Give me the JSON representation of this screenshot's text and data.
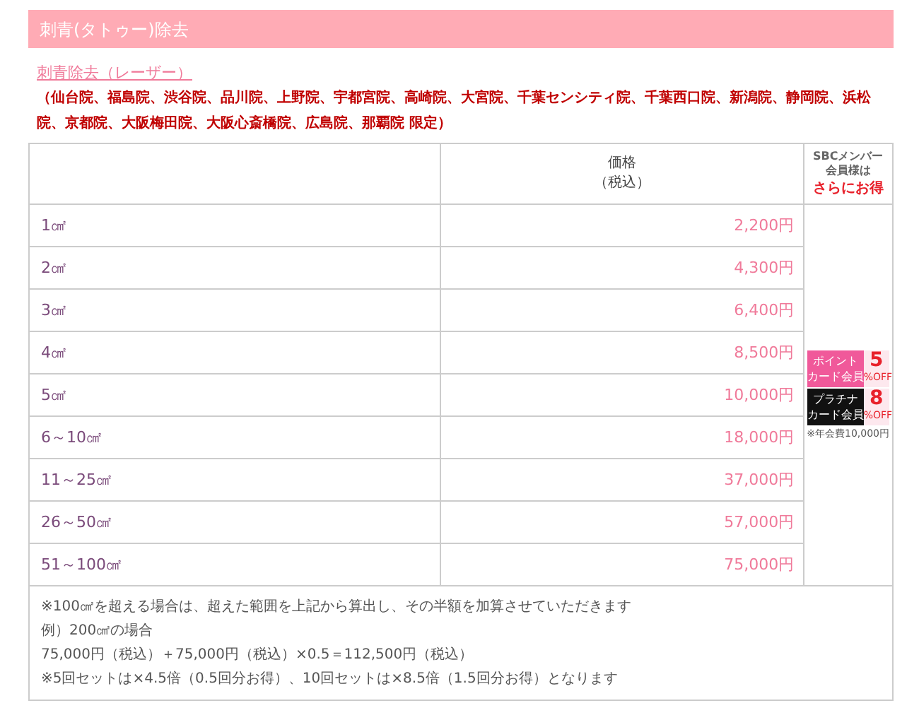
{
  "header": {
    "title": "刺青(タトゥー)除去"
  },
  "link": "刺青除去（レーザー）",
  "clinics_note": "（仙台院、福島院、渋谷院、品川院、上野院、宇都宮院、高崎院、大宮院、千葉センシティ院、千葉西口院、新潟院、静岡院、浜松院、京都院、大阪梅田院、大阪心斎橋院、広島院、那覇院 限定）",
  "table": {
    "columns": [
      {
        "lines": [
          "価格",
          "（税込）"
        ]
      },
      {
        "lines": [
          "SBCメンバー",
          "会員様は"
        ],
        "highlight": "さらにお得"
      }
    ],
    "rows": [
      {
        "size": "1㎠",
        "price": "2,200円"
      },
      {
        "size": "2㎠",
        "price": "4,300円"
      },
      {
        "size": "3㎠",
        "price": "6,400円"
      },
      {
        "size": "4㎠",
        "price": "8,500円"
      },
      {
        "size": "5㎠",
        "price": "10,000円"
      },
      {
        "size": "6～10㎠",
        "price": "18,000円"
      },
      {
        "size": "11～25㎠",
        "price": "37,000円"
      },
      {
        "size": "26～50㎠",
        "price": "57,000円"
      },
      {
        "size": "51～100㎠",
        "price": "75,000円"
      }
    ],
    "discounts": [
      {
        "kind": "point",
        "label": [
          "ポイント",
          "カード会員"
        ],
        "value": "5",
        "unit": "%OFF"
      },
      {
        "kind": "platinum",
        "label": [
          "プラチナ",
          "カード会員"
        ],
        "value": "8",
        "unit": "%OFF"
      }
    ],
    "discount_note": "※年会費10,000円",
    "notes": [
      "※100㎠を超える場合は、超えた範囲を上記から算出し、その半額を加算させていただきます",
      "例）200㎠の場合",
      "75,000円（税込）＋75,000円（税込）×0.5＝112,500円（税込）",
      "※5回セットは×4.5倍（0.5回分お得）、10回セットは×8.5倍（1.5回分お得）となります"
    ]
  }
}
